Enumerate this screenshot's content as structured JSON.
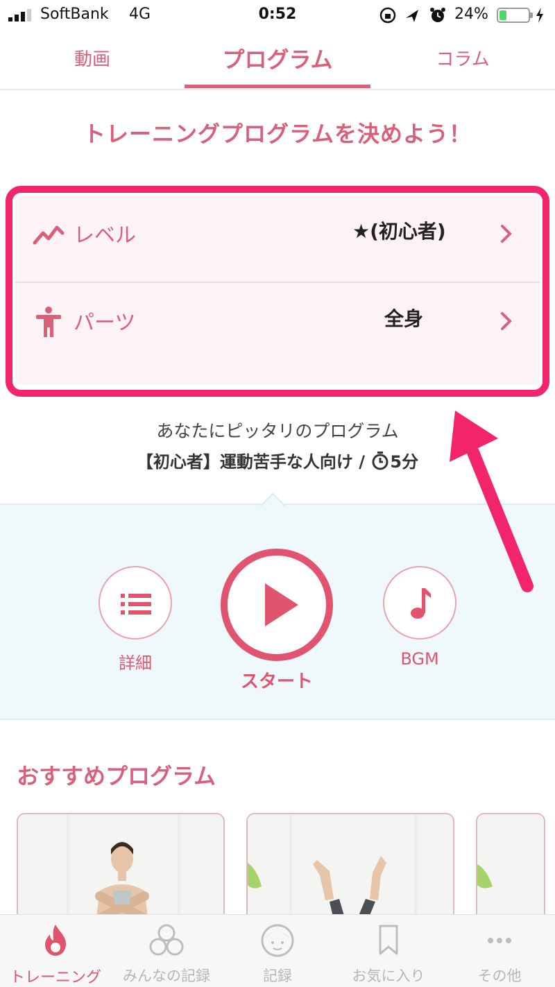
{
  "status_bar": {
    "carrier": "SoftBank",
    "network": "4G",
    "time": "0:52",
    "battery_percent": "24%",
    "battery_level": 0.24,
    "icons": [
      "signal-icon",
      "lock-rotation-icon",
      "location-icon",
      "alarm-icon",
      "battery-icon",
      "charging-icon"
    ]
  },
  "tabs": [
    {
      "label": "動画",
      "active": false
    },
    {
      "label": "プログラム",
      "active": true
    },
    {
      "label": "コラム",
      "active": false
    }
  ],
  "headline": "トレーニングプログラムを決めよう！",
  "settings": {
    "level": {
      "label": "レベル",
      "value": "★(初心者)",
      "icon": "trend-icon"
    },
    "parts": {
      "label": "パーツ",
      "value": "全身",
      "icon": "body-icon"
    }
  },
  "match": {
    "text": "あなたにピッタリのプログラム",
    "detail_prefix": "【初心者】運動苦手な人向け / ",
    "duration": "5分"
  },
  "actions": {
    "detail_label": "詳細",
    "start_label": "スタート",
    "bgm_label": "BGM"
  },
  "recommend": {
    "title": "おすすめプログラム"
  },
  "bottom_nav": [
    {
      "label": "トレーニング",
      "icon": "flame-icon",
      "active": true
    },
    {
      "label": "みんなの記録",
      "icon": "people-icon",
      "active": false
    },
    {
      "label": "記録",
      "icon": "face-icon",
      "active": false
    },
    {
      "label": "お気に入り",
      "icon": "bookmark-icon",
      "active": false
    },
    {
      "label": "その他",
      "icon": "more-icon",
      "active": false
    }
  ],
  "colors": {
    "accent": "#d9607a",
    "highlight": "#f2256c",
    "panel_bg": "#eff8fb",
    "card_bg": "#fdf3f6"
  }
}
